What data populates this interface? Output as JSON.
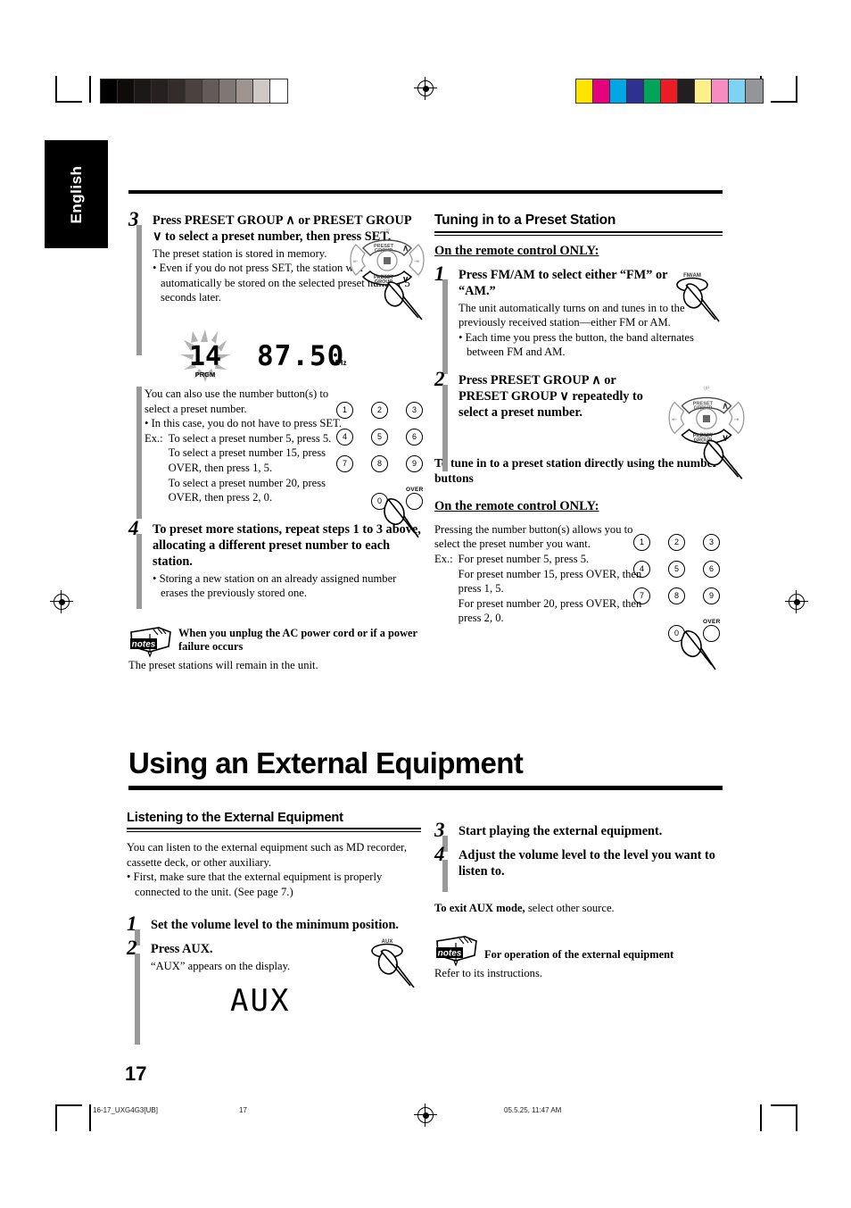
{
  "page": {
    "language_tab": "English",
    "page_number": "17",
    "footer_left": "16-17_UXG4G3[UB]",
    "footer_center": "17",
    "footer_right": "05.5.25, 11:47 AM"
  },
  "colors": {
    "grayscale_bar": [
      "#000000",
      "#0f0b0b",
      "#1c1717",
      "#262020",
      "#342c2a",
      "#4b4240",
      "#645a57",
      "#7f7774",
      "#9d9490",
      "#cfc8c5",
      "#ffffff"
    ],
    "color_bar": [
      "#ffe400",
      "#e5017f",
      "#00a7e4",
      "#2e3191",
      "#00a55a",
      "#ed1c24",
      "#231f20",
      "#fdf08a",
      "#f78cc0",
      "#7fd3f2",
      "#939598"
    ],
    "step_bar": "#999999",
    "tab_background": "#000000"
  },
  "left_column": {
    "step3": {
      "number": "3",
      "heading": "Press PRESET GROUP ∧ or PRESET GROUP ∨ to select a preset number, then press SET.",
      "line1": "The preset station is stored in memory.",
      "bullet1": "Even if you do not press SET, the station will automatically be stored on the selected preset number 5 seconds later."
    },
    "display_preset": {
      "preset_number": "14",
      "indicator": "PRGM",
      "frequency": "87.50",
      "unit": "MHz"
    },
    "number_note": {
      "line1": "You can also use the number button(s) to select a preset number.",
      "bullet1": "In this case, you do not have to press SET.",
      "ex_label": "Ex.:",
      "ex_lines": [
        "To select a preset number 5, press 5.",
        "To select a preset number 15, press OVER, then press 1, 5.",
        "To select a preset number 20, press OVER, then press 2, 0."
      ]
    },
    "step4": {
      "number": "4",
      "heading": "To preset more stations, repeat steps 1 to 3 above, allocating a different preset number to each station.",
      "bullet1": "Storing a new station on an already assigned number erases the previously stored one."
    },
    "notes": {
      "icon_label": "notes",
      "title": "When you unplug the AC power cord or if a power failure occurs",
      "text": "The preset stations will remain in the unit."
    }
  },
  "right_column": {
    "section_title": "Tuning in to a Preset Station",
    "remote_only_1": "On the remote control ONLY:",
    "step1": {
      "number": "1",
      "heading": "Press FM/AM to select either “FM” or “AM.”",
      "line1": "The unit automatically turns on and tunes in to the previously received station—either FM or AM.",
      "bullet1": "Each time you press the button, the band alternates between FM and AM."
    },
    "fm_am_button_label": "FM/AM",
    "step2": {
      "number": "2",
      "heading": "Press PRESET GROUP ∧ or PRESET GROUP ∨ repeatedly to select a preset number."
    },
    "direct_tune_heading": "To tune in to a preset station directly using the number buttons",
    "remote_only_2": "On the remote control ONLY:",
    "direct_tune": {
      "line1": "Pressing the number button(s) allows you to select the preset number you want.",
      "ex_label": "Ex.:",
      "ex_lines": [
        "For preset number 5, press 5.",
        "For preset number 15, press OVER, then press 1, 5.",
        "For preset number 20, press OVER, then press 2, 0."
      ]
    }
  },
  "chapter": {
    "title": "Using an External Equipment"
  },
  "external": {
    "section_title": "Listening to the External Equipment",
    "intro": "You can listen to the external equipment such as MD recorder, cassette deck, or other auxiliary.",
    "bullet1": "First, make sure that the external equipment is properly connected to the unit. (See page 7.)",
    "step1": {
      "number": "1",
      "heading": "Set the volume level to the minimum position."
    },
    "step2": {
      "number": "2",
      "heading": "Press AUX.",
      "line1": "“AUX” appears on the display."
    },
    "aux_button_label": "AUX",
    "display_aux": "AUX",
    "step3": {
      "number": "3",
      "heading": "Start playing the external equipment."
    },
    "step4": {
      "number": "4",
      "heading": "Adjust the volume level to the level you want to listen to."
    },
    "exit_bold": "To exit AUX mode,",
    "exit_rest": " select other source.",
    "notes": {
      "icon_label": "notes",
      "title": "For operation of the external equipment",
      "text": "Refer to its instructions."
    }
  },
  "keypad": {
    "keys": [
      "1",
      "2",
      "3",
      "4",
      "5",
      "6",
      "7",
      "8",
      "9",
      "0"
    ],
    "over_label": "OVER"
  },
  "dpad": {
    "up_label": "UP",
    "down_label": "DOWN",
    "preset_up": "PRESET GROUP ∧",
    "preset_down": "PRESET GROUP ∨"
  }
}
